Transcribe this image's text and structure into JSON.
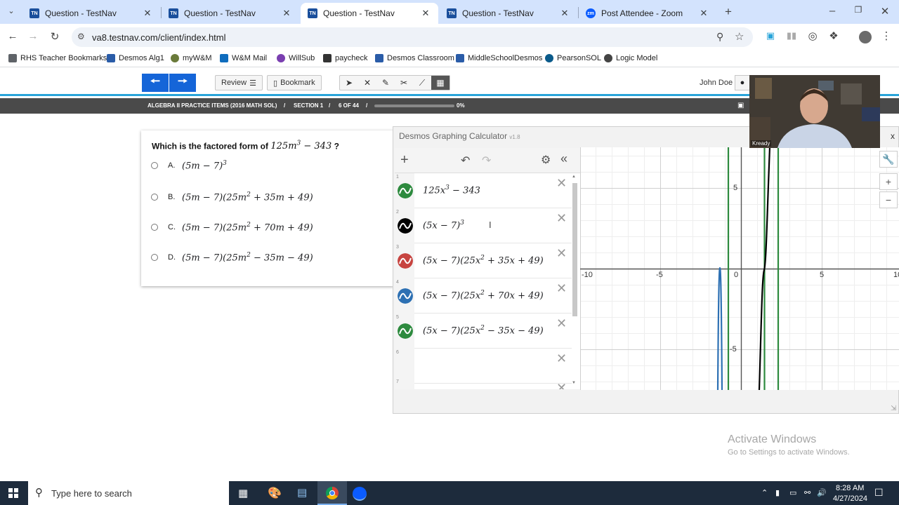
{
  "browser": {
    "tabs": [
      {
        "title": "Question - TestNav",
        "favicon": "TN",
        "active": false
      },
      {
        "title": "Question - TestNav",
        "favicon": "TN",
        "active": false
      },
      {
        "title": "Question - TestNav",
        "favicon": "TN",
        "active": true
      },
      {
        "title": "Question - TestNav",
        "favicon": "TN",
        "active": false
      },
      {
        "title": "Post Attendee - Zoom",
        "favicon": "zm",
        "active": false
      }
    ],
    "url": "va8.testnav.com/client/index.html",
    "bookmarks": [
      {
        "label": "RHS Teacher Bookmarks",
        "color": "#5f6368"
      },
      {
        "label": "Desmos Alg1",
        "color": "#2a5ca8"
      },
      {
        "label": "myW&M",
        "color": "#6a7a3a"
      },
      {
        "label": "W&M Mail",
        "color": "#0f6cbd"
      },
      {
        "label": "WillSub",
        "color": "#7a3fb0"
      },
      {
        "label": "paycheck",
        "color": "#333333"
      },
      {
        "label": "Desmos Classroom",
        "color": "#2a5ca8"
      },
      {
        "label": "MiddleSchoolDesmos",
        "color": "#2a5ca8"
      },
      {
        "label": "PearsonSOL",
        "color": "#0a5a8a"
      },
      {
        "label": "Logic Model",
        "color": "#444444"
      }
    ]
  },
  "testnav": {
    "review_label": "Review",
    "bookmark_label": "Bookmark",
    "user_name": "John Doe",
    "info": {
      "section_title": "ALGEBRA II PRACTICE ITEMS (2016 MATH SOL)",
      "section": "SECTION 1",
      "position": "6 OF 44",
      "progress_text": "0%",
      "progress": 0
    },
    "accent": "#1565d8"
  },
  "question": {
    "prompt": "Which is the factored form of",
    "prompt_end": "?",
    "options": [
      {
        "letter": "A."
      },
      {
        "letter": "B."
      },
      {
        "letter": "C."
      },
      {
        "letter": "D."
      }
    ]
  },
  "desmos": {
    "title": "Desmos Graphing Calculator",
    "version": "v1.8",
    "expressions": [
      {
        "index": "1",
        "color": "#2d8a3e"
      },
      {
        "index": "2",
        "color": "#000000"
      },
      {
        "index": "3",
        "color": "#c74440"
      },
      {
        "index": "4",
        "color": "#2d70b3"
      },
      {
        "index": "5",
        "color": "#2d8a3e"
      },
      {
        "index": "6"
      },
      {
        "index": "7"
      }
    ],
    "axis_labels": {
      "x": [
        "-10",
        "-5",
        "0",
        "5",
        "10"
      ],
      "y": [
        "5",
        "-5"
      ]
    }
  },
  "webcam": {
    "label": "Kready"
  },
  "watermark": {
    "title": "Activate Windows",
    "subtitle": "Go to Settings to activate Windows."
  },
  "taskbar": {
    "search_placeholder": "Type here to search",
    "time": "8:28 AM",
    "date": "4/27/2024"
  }
}
